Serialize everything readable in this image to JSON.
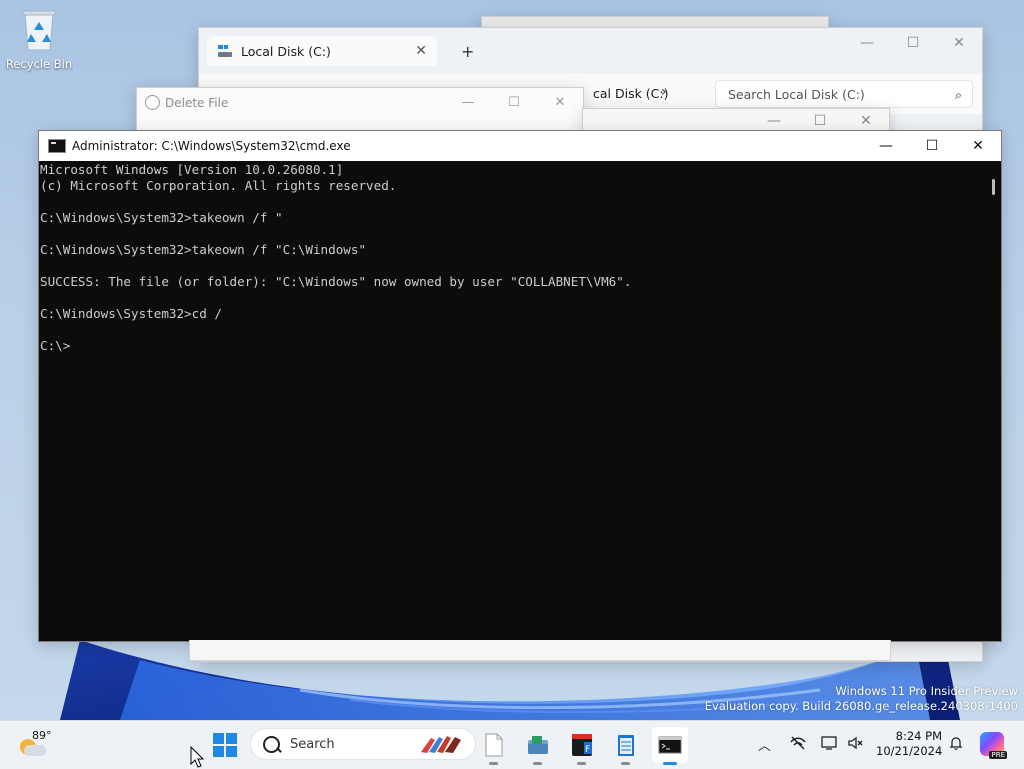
{
  "desktop": {
    "recycle_bin_label": "Recycle Bin",
    "watermark_line1": "Windows 11 Pro Insider Preview",
    "watermark_line2": "Evaluation copy. Build 26080.ge_release.240308-1400"
  },
  "explorer": {
    "tab_label": "Local Disk (C:)",
    "breadcrumb_partial": "cal Disk (C:)",
    "search_placeholder": "Search Local Disk (C:)"
  },
  "delete_dialog": {
    "title": "Delete File"
  },
  "cmd": {
    "title": "Administrator: C:\\Windows\\System32\\cmd.exe",
    "lines": [
      "Microsoft Windows [Version 10.0.26080.1]",
      "(c) Microsoft Corporation. All rights reserved.",
      "",
      "C:\\Windows\\System32>takeown /f \"",
      "",
      "C:\\Windows\\System32>takeown /f \"C:\\Windows\"",
      "",
      "SUCCESS: The file (or folder): \"C:\\Windows\" now owned by user \"COLLABNET\\VM6\".",
      "",
      "C:\\Windows\\System32>cd /",
      "",
      "C:\\>"
    ]
  },
  "taskbar": {
    "weather_temp": "89°",
    "search_placeholder": "Search",
    "apps": [
      "start-icon",
      "search-box",
      "file-icon",
      "file-explorer-icon",
      "database-app-icon",
      "notepad-icon",
      "terminal-icon"
    ],
    "clock_time": "8:24 PM",
    "clock_date": "10/21/2024",
    "copilot_badge": "PRE"
  },
  "colors": {
    "console_bg": "#0c0c0c",
    "console_fg": "#cccccc",
    "taskbar_bg": "#eef2f7",
    "accent": "#1e88e5"
  }
}
